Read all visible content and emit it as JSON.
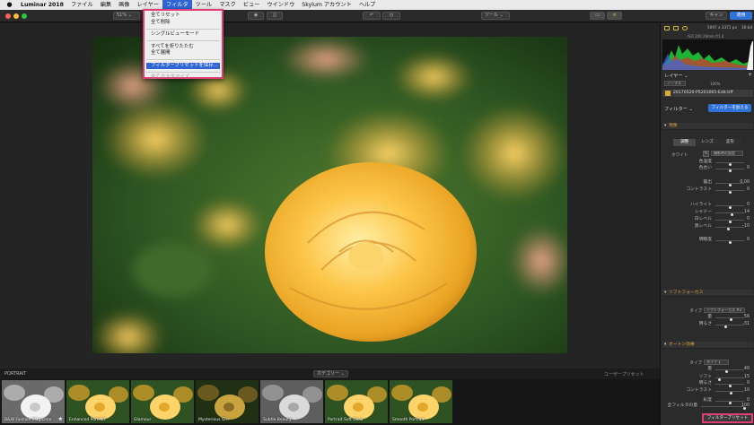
{
  "menubar": {
    "apple": "",
    "items": [
      "Luminar 2018",
      "ファイル",
      "編集",
      "画像",
      "レイヤー",
      "フィルタ",
      "ツール",
      "マスク",
      "ビュー",
      "ウインドウ",
      "Skylum アカウント",
      "ヘルプ"
    ]
  },
  "toolbar": {
    "zoom": "51%",
    "tools": "ツール",
    "cancel": "キャン",
    "apply": "適用"
  },
  "filter_menu": {
    "items": [
      {
        "label": "全てリセット",
        "kind": "normal"
      },
      {
        "label": "全て削除",
        "kind": "normal"
      },
      {
        "kind": "sep"
      },
      {
        "label": "シングルビューモード",
        "kind": "normal"
      },
      {
        "kind": "sep"
      },
      {
        "label": "すべてを折りたたむ",
        "kind": "normal"
      },
      {
        "label": "全て展開",
        "kind": "normal"
      },
      {
        "kind": "sep"
      },
      {
        "label": "フィルタープリセットを保存...",
        "kind": "selected"
      },
      {
        "kind": "sep"
      },
      {
        "label": "全てカスタマイズ",
        "kind": "disabled"
      }
    ]
  },
  "filmstrip": {
    "category_label": "PORTRAIT",
    "category_button": "カテゴリー ⌄",
    "right_link": "ユーザープリセット",
    "presets": [
      {
        "name": "B&W Fashion Magazine",
        "style": "bw"
      },
      {
        "name": "Enhanced Portrait",
        "style": "color"
      },
      {
        "name": "Glamour",
        "style": "color"
      },
      {
        "name": "Mysterious Girl",
        "style": "dark"
      },
      {
        "name": "Subtle Beauty",
        "style": "gray"
      },
      {
        "name": "Portrait Soft Glow",
        "style": "color"
      },
      {
        "name": "Smooth Portrait",
        "style": "color"
      }
    ]
  },
  "panel": {
    "info": {
      "dims": "5097 x 3371 px",
      "bit": "16-bit",
      "meta": "ISO 200   29mm   f/1.4"
    },
    "layers_title": "レイヤー ⌄",
    "layer_mode": "ノーマル",
    "layer_opacity": "100%",
    "layer_file": "20170520-P5201065-Edit.tiff",
    "filters_title": "フィルター ⌄",
    "add_filter": "フィルターを加える",
    "develop": {
      "title": "現像",
      "tabs": [
        "調整",
        "レンズ",
        "変形"
      ],
      "wb_label": "ホワイト",
      "wb_value": "撮影時の設定",
      "rows": [
        {
          "label": "色温度",
          "value": "",
          "pos": 0.5
        },
        {
          "label": "色合い",
          "value": "0",
          "pos": 0.5
        },
        {
          "label": "露出",
          "value": "0.00",
          "pos": 0.5
        },
        {
          "label": "コントラスト",
          "value": "0",
          "pos": 0.5
        },
        {
          "label": "ハイライト",
          "value": "0",
          "pos": 0.5
        },
        {
          "label": "シャドー",
          "value": "14",
          "pos": 0.57
        },
        {
          "label": "白レベル",
          "value": "0",
          "pos": 0.5
        },
        {
          "label": "黒レベル",
          "value": "-10",
          "pos": 0.45
        },
        {
          "label": "明瞭度",
          "value": "0",
          "pos": 0.5
        }
      ]
    },
    "soft_focus": {
      "title": "ソフトフォーカス",
      "type_label": "タイプ",
      "type_value": "ソフトフォーカス #2",
      "rows": [
        {
          "label": "量",
          "value": "56",
          "pos": 0.56
        },
        {
          "label": "明るさ",
          "value": "-31",
          "pos": 0.35
        }
      ]
    },
    "orton": {
      "title": "オートン効果",
      "type_label": "タイプ",
      "type_value": "タイプ 1",
      "rows": [
        {
          "label": "量",
          "value": "40",
          "pos": 0.4
        },
        {
          "label": "ソフト",
          "value": "15",
          "pos": 0.15
        },
        {
          "label": "明るさ",
          "value": "0",
          "pos": 0.5
        },
        {
          "label": "コントラスト",
          "value": "10",
          "pos": 0.55
        },
        {
          "label": "彩度",
          "value": "0",
          "pos": 0.5
        }
      ]
    },
    "all_filters_label": "全フィルタの量",
    "all_filters_value": "100",
    "all_filters_pos": 1.0,
    "save_preset": "フィルタープリセット"
  },
  "colors": {
    "accent": "#2f72d8",
    "highlight": "#e23d79",
    "section": "#d9a13b"
  }
}
